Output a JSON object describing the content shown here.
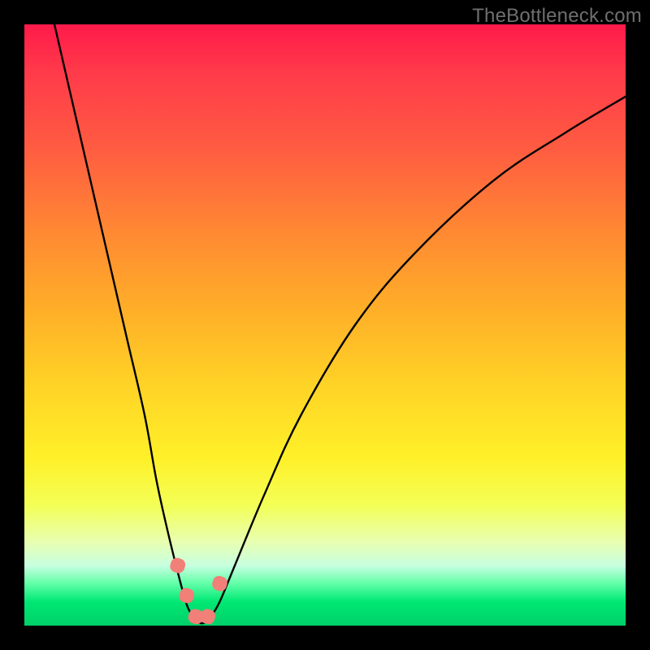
{
  "watermark": "TheBottleneck.com",
  "chart_data": {
    "type": "line",
    "title": "",
    "xlabel": "",
    "ylabel": "",
    "xlim": [
      0,
      100
    ],
    "ylim": [
      0,
      100
    ],
    "series": [
      {
        "name": "bottleneck-curve",
        "x": [
          5,
          8,
          11,
          14,
          17,
          20,
          22,
          24,
          26,
          27,
          28,
          29,
          30,
          31,
          32.5,
          35,
          40,
          46,
          55,
          65,
          78,
          90,
          100
        ],
        "y": [
          100,
          87,
          74,
          61,
          48,
          35,
          24,
          15,
          7,
          3.5,
          1.5,
          0.5,
          0.5,
          1.5,
          4,
          10,
          22,
          35,
          50,
          62,
          74,
          82,
          88
        ]
      }
    ],
    "markers": [
      {
        "name": "dot-left-upper",
        "x": 25.5,
        "y": 10,
        "color": "#f08078",
        "size": 18
      },
      {
        "name": "dot-left-mid",
        "x": 27,
        "y": 5,
        "color": "#f08078",
        "size": 18
      },
      {
        "name": "dot-bottom-left",
        "x": 28.5,
        "y": 1.5,
        "color": "#f08078",
        "size": 18
      },
      {
        "name": "dot-bottom-right",
        "x": 30.5,
        "y": 1.5,
        "color": "#f08078",
        "size": 18
      },
      {
        "name": "dot-right-upper",
        "x": 32.5,
        "y": 7,
        "color": "#f08078",
        "size": 18
      }
    ],
    "background_gradient": {
      "type": "vertical",
      "stops": [
        {
          "pos": 0,
          "color": "#ff1a4a"
        },
        {
          "pos": 0.5,
          "color": "#ffc028"
        },
        {
          "pos": 0.8,
          "color": "#f8ff50"
        },
        {
          "pos": 1.0,
          "color": "#00d068"
        }
      ]
    }
  }
}
